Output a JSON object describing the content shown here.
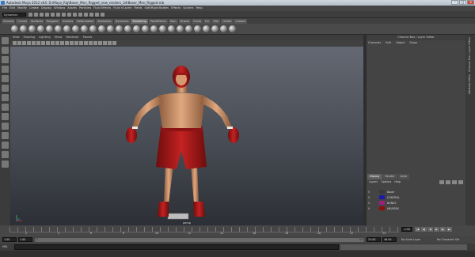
{
  "window": {
    "title": "Autodesk Maya 2012 x64: D:\\Maya_Rig\\Boxer_Men_Rigged_new_renders_3d\\Boxer_Men_Rigged.mb",
    "buttons": [
      "–",
      "□",
      "✕"
    ]
  },
  "menubar": [
    "File",
    "Edit",
    "Modify",
    "Create",
    "Display",
    "Window",
    "Assets",
    "Particles",
    "Fluid Effects",
    "Fluid nCache",
    "Fields",
    "Soft/Rigid Bodies",
    "Effects",
    "Solvers",
    "Help"
  ],
  "statusline": {
    "mode": "Dynamics"
  },
  "shelf": {
    "tabs": [
      "General",
      "Curves",
      "Surfaces",
      "Polygons",
      "Subdivs",
      "Deformation",
      "Animation",
      "Dynamics",
      "Rendering",
      "PaintEffects",
      "Toon",
      "Muscle",
      "Fluids",
      "Fur",
      "Hair",
      "nCloth",
      "Custom"
    ],
    "active_tab": "Rendering"
  },
  "viewport": {
    "menu": [
      "View",
      "Shading",
      "Lighting",
      "Show",
      "Renderer",
      "Panels"
    ],
    "camera_label": "persp"
  },
  "channel_box": {
    "title": "Channel Box / Layer Editor",
    "menu": [
      "Channels",
      "Edit",
      "Object",
      "Show"
    ]
  },
  "layer_editor": {
    "tabs": [
      "Display",
      "Render",
      "Anim"
    ],
    "active_tab": "Display",
    "menu": [
      "Layers",
      "Options",
      "Help"
    ],
    "layers": [
      {
        "visible": "V",
        "name": "Boxer",
        "color": "#3a3a3a"
      },
      {
        "visible": "V",
        "name": "CONTROL",
        "color": "#1a1aa8"
      },
      {
        "visible": "V",
        "name": "BONES",
        "color": "#a01e7d"
      },
      {
        "visible": "V",
        "name": "HELPERS",
        "color": "#8c1010"
      }
    ]
  },
  "right_tabs": [
    "Channel Box / Layer Editor",
    "Attribute Editor"
  ],
  "time_slider": {
    "tick_labels": [
      "2",
      "4",
      "6",
      "8",
      "10",
      "12",
      "14",
      "16",
      "18",
      "20",
      "22",
      "24"
    ],
    "current_frame": "1.00",
    "playback_buttons": [
      "|◀",
      "◀|",
      "◀",
      "▶",
      "▶|",
      "▶|"
    ]
  },
  "range_slider": {
    "start": "1.00",
    "inner_start": "1.00",
    "bar_start_label": "1",
    "bar_end_label": "24",
    "inner_end": "24.00",
    "end": "48.00",
    "anim_layer": "No Anim Layer",
    "char_set": "No Character Set"
  },
  "command_line": {
    "label": "MEL"
  }
}
